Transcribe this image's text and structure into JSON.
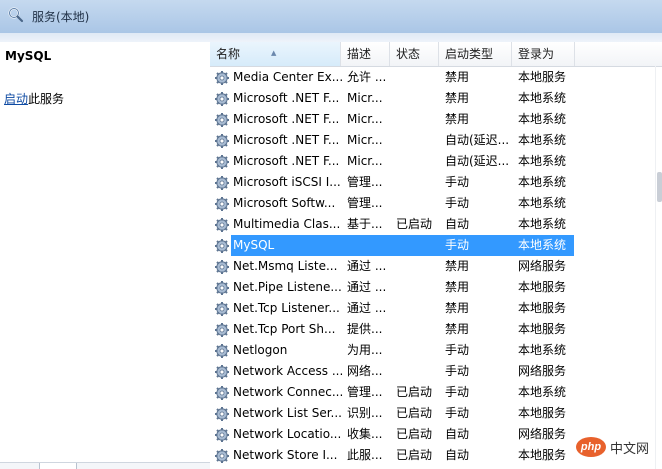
{
  "window": {
    "title": "服务(本地)"
  },
  "left": {
    "service_name": "MySQL",
    "start_link": "启动",
    "start_suffix": "此服务"
  },
  "columns": [
    {
      "label": "名称"
    },
    {
      "label": "描述"
    },
    {
      "label": "状态"
    },
    {
      "label": "启动类型"
    },
    {
      "label": "登录为"
    }
  ],
  "rows": [
    {
      "name": "Media Center Ex...",
      "desc": "允许 ...",
      "status": "",
      "startup": "禁用",
      "logon": "本地服务"
    },
    {
      "name": "Microsoft .NET F...",
      "desc": "Micr...",
      "status": "",
      "startup": "禁用",
      "logon": "本地系统"
    },
    {
      "name": "Microsoft .NET F...",
      "desc": "Micr...",
      "status": "",
      "startup": "禁用",
      "logon": "本地系统"
    },
    {
      "name": "Microsoft .NET F...",
      "desc": "Micr...",
      "status": "",
      "startup": "自动(延迟...",
      "logon": "本地系统"
    },
    {
      "name": "Microsoft .NET F...",
      "desc": "Micr...",
      "status": "",
      "startup": "自动(延迟...",
      "logon": "本地系统"
    },
    {
      "name": "Microsoft iSCSI I...",
      "desc": "管理...",
      "status": "",
      "startup": "手动",
      "logon": "本地系统"
    },
    {
      "name": "Microsoft Softw...",
      "desc": "管理...",
      "status": "",
      "startup": "手动",
      "logon": "本地系统"
    },
    {
      "name": "Multimedia Clas...",
      "desc": "基于...",
      "status": "已启动",
      "startup": "自动",
      "logon": "本地系统"
    },
    {
      "name": "MySQL",
      "desc": "",
      "status": "",
      "startup": "手动",
      "logon": "本地系统",
      "selected": true
    },
    {
      "name": "Net.Msmq Liste...",
      "desc": "通过 ...",
      "status": "",
      "startup": "禁用",
      "logon": "网络服务"
    },
    {
      "name": "Net.Pipe Listene...",
      "desc": "通过 ...",
      "status": "",
      "startup": "禁用",
      "logon": "本地服务"
    },
    {
      "name": "Net.Tcp Listener...",
      "desc": "通过 ...",
      "status": "",
      "startup": "禁用",
      "logon": "本地服务"
    },
    {
      "name": "Net.Tcp Port Sh...",
      "desc": "提供...",
      "status": "",
      "startup": "禁用",
      "logon": "本地服务"
    },
    {
      "name": "Netlogon",
      "desc": "为用...",
      "status": "",
      "startup": "手动",
      "logon": "本地系统"
    },
    {
      "name": "Network Access ...",
      "desc": "网络...",
      "status": "",
      "startup": "手动",
      "logon": "网络服务"
    },
    {
      "name": "Network Connec...",
      "desc": "管理...",
      "status": "已启动",
      "startup": "手动",
      "logon": "本地系统"
    },
    {
      "name": "Network List Ser...",
      "desc": "识别...",
      "status": "已启动",
      "startup": "手动",
      "logon": "本地服务"
    },
    {
      "name": "Network Locatio...",
      "desc": "收集...",
      "status": "已启动",
      "startup": "自动",
      "logon": "网络服务"
    },
    {
      "name": "Network Store I...",
      "desc": "此服...",
      "status": "已启动",
      "startup": "自动",
      "logon": "本地服务"
    }
  ],
  "watermark": {
    "logo": "php",
    "text": "中文网"
  },
  "colors": {
    "selection": "#3399ff",
    "link": "#0f4ba3",
    "titlebar": "#aac6e6"
  },
  "icons": {
    "title": "search-magnifier-icon",
    "row": "service-gear-icon"
  }
}
